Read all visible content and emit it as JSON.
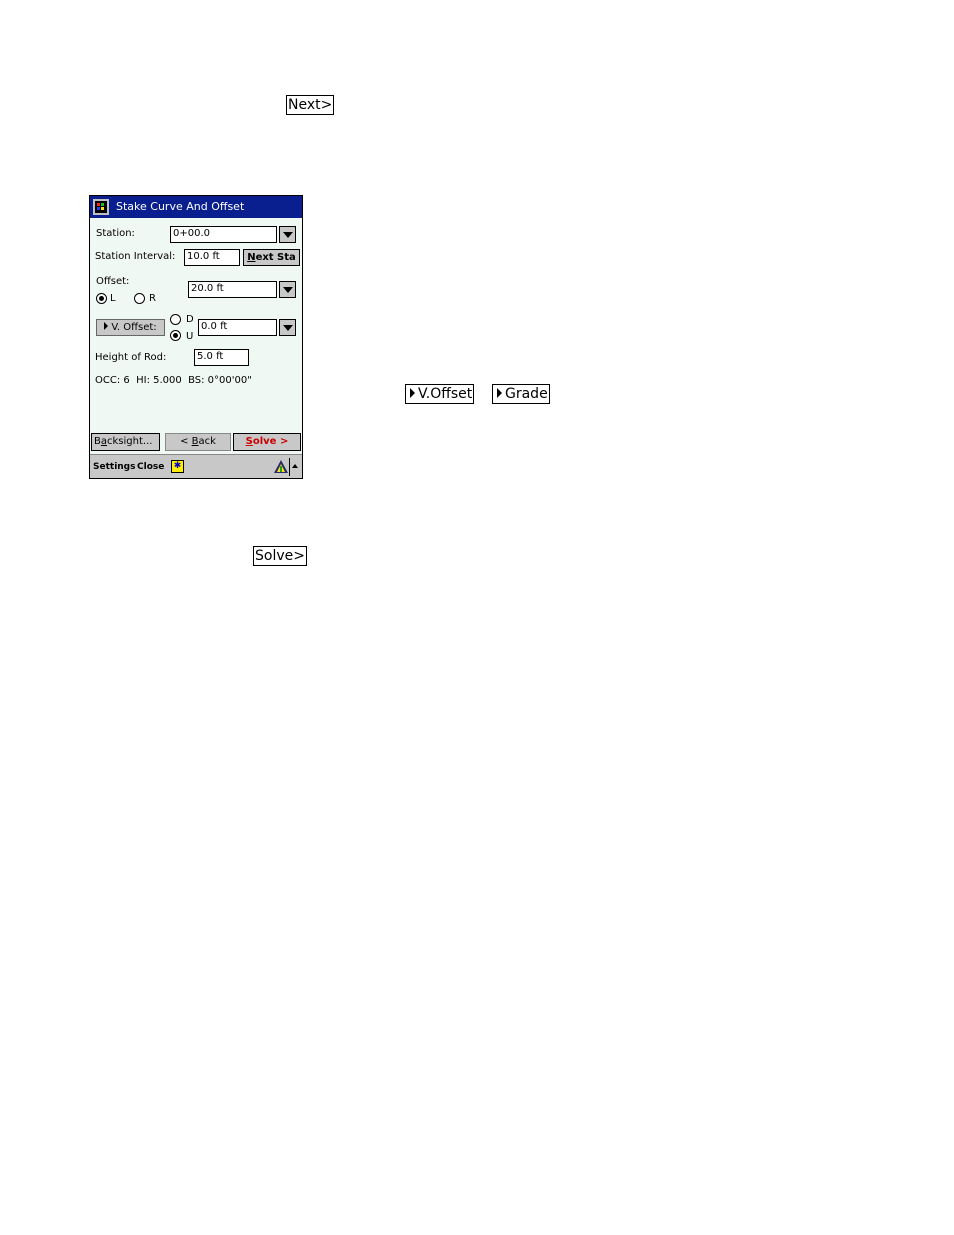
{
  "doc": {
    "next_button": "Next>",
    "voffset_button": "V.Offset",
    "grade_button": "Grade",
    "solve_button": "Solve>"
  },
  "device": {
    "title": "Stake Curve And Offset",
    "station": {
      "label": "Station:",
      "value": "0+00.0"
    },
    "station_interval": {
      "label": "Station Interval:",
      "value": "10.0 ft",
      "next_sta_button": "ext Sta",
      "next_sta_mnemonic": "N"
    },
    "offset": {
      "label": "Offset:",
      "value": "20.0 ft",
      "left_label": "L",
      "right_label": "R",
      "selected": "L"
    },
    "v_offset": {
      "button_label": "V. Offset:",
      "value": "0.0 ft",
      "down_label": "D",
      "up_label": "U",
      "selected": "U"
    },
    "height_of_rod": {
      "label": "Height of Rod:",
      "value": "5.0 ft"
    },
    "status_line": "OCC: 6  HI: 5.000  BS: 0°00'00\"",
    "buttons": {
      "backsight_pre": "B",
      "backsight_mn": "a",
      "backsight_post": "cksight...",
      "back_pre": "< ",
      "back_mn": "B",
      "back_post": "ack",
      "solve_mn": "S",
      "solve_post": "olve >"
    },
    "menubar": {
      "settings": "Settings",
      "close": "Close"
    },
    "colors": {
      "titlebar": "#0a1f8f",
      "solve_text": "#cc0000",
      "keyboard_icon": "#ffee00"
    }
  }
}
